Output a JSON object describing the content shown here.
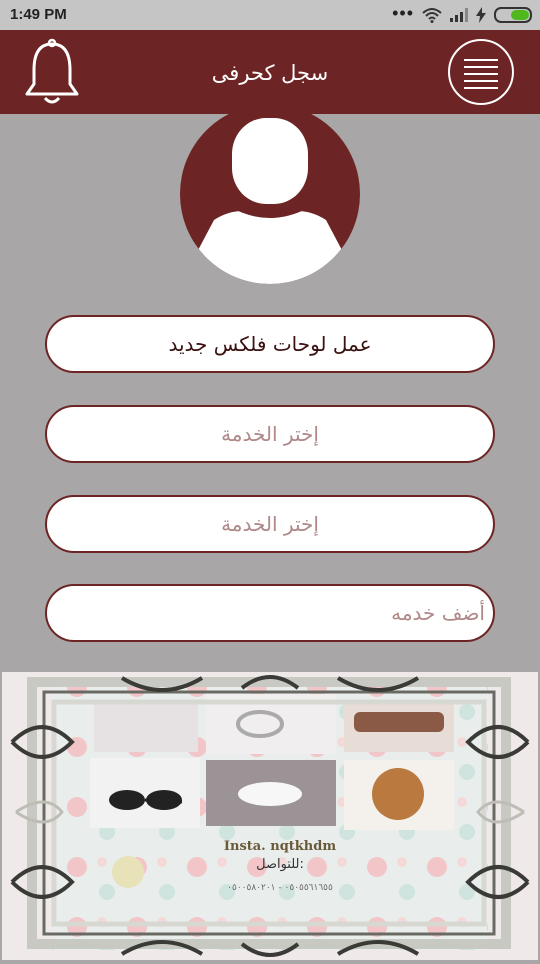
{
  "status": {
    "time": "1:49 PM",
    "dots": "•••"
  },
  "header": {
    "title": "سجل كحرفى"
  },
  "form": {
    "service_name": "عمل لوحات فلكس جديد",
    "service_select_1": "إختر الخدمة",
    "service_select_2": "إختر الخدمة",
    "add_service": "أضف خدمه"
  },
  "ad": {
    "insta": "Insta. nqtkhdm",
    "contact": "للتواصل:",
    "phones": "٠٥٠٥٥٦١٦٥٥ - ٠٥٠٠٥٨٠٢٠١"
  },
  "colors": {
    "brand": "#6d2424",
    "background": "#a8a6a6",
    "battery": "#4fb81c"
  },
  "icons": [
    "bell-icon",
    "menu-icon",
    "avatar-icon",
    "wifi-icon",
    "signal-icon",
    "charging-icon",
    "battery-icon"
  ]
}
